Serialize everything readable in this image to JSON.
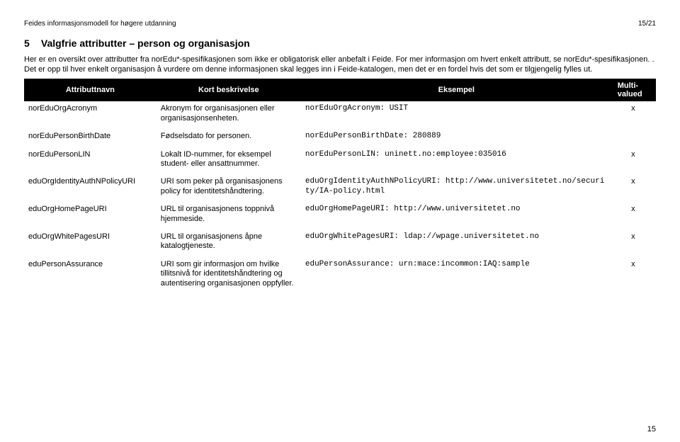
{
  "header": {
    "doc_title": "Feides informasjonsmodell for høgere utdanning",
    "page_indicator": "15/21"
  },
  "section": {
    "number": "5",
    "title": "Valgfrie attributter – person og organisasjon"
  },
  "intro": {
    "p1": "Her er en oversikt over attributter fra norEdu*-spesifikasjonen som ikke er obligatorisk eller anbefalt i Feide. For mer informasjon om hvert enkelt attributt, se norEdu*-spesifikasjonen. . Det er opp til hver enkelt organisasjon å vurdere om denne informasjonen skal legges inn i Feide-katalogen, men det er en fordel hvis det som er tilgjengelig fylles ut."
  },
  "table": {
    "headers": {
      "name": "Attributtnavn",
      "desc": "Kort beskrivelse",
      "example": "Eksempel",
      "multivalued_l1": "Multi-",
      "multivalued_l2": "valued"
    },
    "rows": [
      {
        "name": "norEduOrgAcronym",
        "desc": "Akronym for organisasjonen eller organisasjonsenheten.",
        "example": "norEduOrgAcronym: USIT",
        "mv": "x"
      },
      {
        "name": "norEduPersonBirthDate",
        "desc": "Fødselsdato for personen.",
        "example": "norEduPersonBirthDate: 280889",
        "mv": ""
      },
      {
        "name": "norEduPersonLIN",
        "desc": "Lokalt ID-nummer, for eksempel student- eller ansattnummer.",
        "example": "norEduPersonLIN: uninett.no:employee:035016",
        "mv": "x"
      },
      {
        "name": "eduOrgIdentityAuthNPolicyURI",
        "desc": "URI som peker på organisasjonens policy for identitetshåndtering.",
        "example": "eduOrgIdentityAuthNPolicyURI: http://www.universitetet.no/security/IA-policy.html",
        "mv": "x"
      },
      {
        "name": "eduOrgHomePageURI",
        "desc": "URL til organisasjonens toppnivå hjemmeside.",
        "example": "eduOrgHomePageURI: http://www.universitetet.no",
        "mv": "x"
      },
      {
        "name": "eduOrgWhitePagesURI",
        "desc": "URL til organisasjonens åpne katalogtjeneste.",
        "example": "eduOrgWhitePagesURI: ldap://wpage.universitetet.no",
        "mv": "x"
      },
      {
        "name": "eduPersonAssurance",
        "desc": "URI som gir informasjon om hvilke tillitsnivå for identitetshåndtering og autentisering organisasjonen oppfyller.",
        "example": "eduPersonAssurance: urn:mace:incommon:IAQ:sample",
        "mv": "x"
      }
    ]
  },
  "footer": {
    "page": "15"
  }
}
